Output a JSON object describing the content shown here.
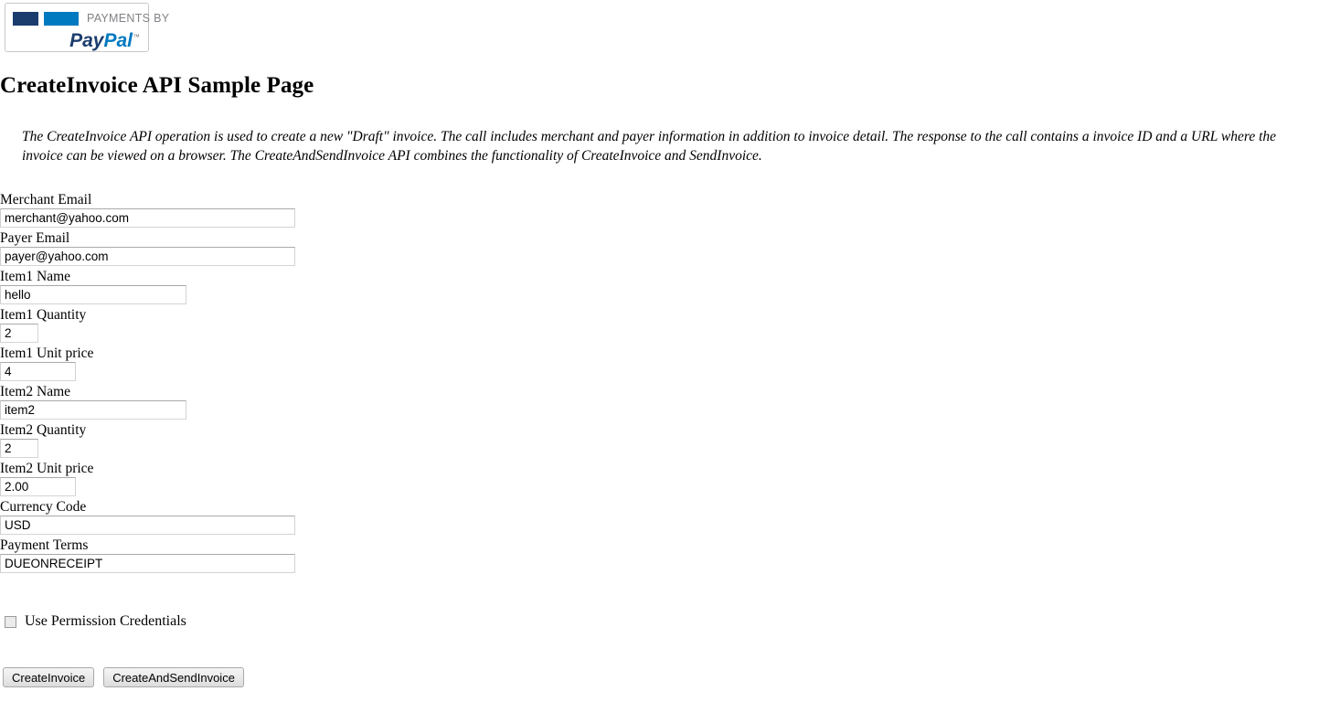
{
  "logo": {
    "payments_by": "PAYMENTS BY",
    "wordmark_first": "Pay",
    "wordmark_second": "Pal",
    "trademark": "™",
    "color_dark": "#1b3d6d",
    "color_blue": "#0079c1",
    "color_text": "#808285"
  },
  "page": {
    "title": "CreateInvoice API Sample Page",
    "intro": "The CreateInvoice API operation is used to create a new \"Draft\" invoice. The call includes merchant and payer information in addition to invoice detail. The response to the call contains a invoice ID and a URL where the invoice can be viewed on a browser. The CreateAndSendInvoice API combines the functionality of CreateInvoice and SendInvoice."
  },
  "form": {
    "fields": [
      {
        "label": "Merchant Email",
        "value": "merchant@yahoo.com",
        "size": "email"
      },
      {
        "label": "Payer Email",
        "value": "payer@yahoo.com",
        "size": "email"
      },
      {
        "label": "Item1 Name",
        "value": "hello",
        "size": "name"
      },
      {
        "label": "Item1 Quantity",
        "value": "2",
        "size": "qty"
      },
      {
        "label": "Item1 Unit price",
        "value": "4",
        "size": "price"
      },
      {
        "label": "Item2 Name",
        "value": "item2",
        "size": "name"
      },
      {
        "label": "Item2 Quantity",
        "value": "2",
        "size": "qty"
      },
      {
        "label": "Item2 Unit price",
        "value": "2.00",
        "size": "price"
      },
      {
        "label": "Currency Code",
        "value": "USD",
        "size": "email"
      },
      {
        "label": "Payment Terms",
        "value": "DUEONRECEIPT",
        "size": "email"
      }
    ],
    "permission_checkbox": {
      "label": "Use Permission Credentials",
      "checked": false
    },
    "buttons": [
      {
        "label": "CreateInvoice"
      },
      {
        "label": "CreateAndSendInvoice"
      }
    ]
  }
}
